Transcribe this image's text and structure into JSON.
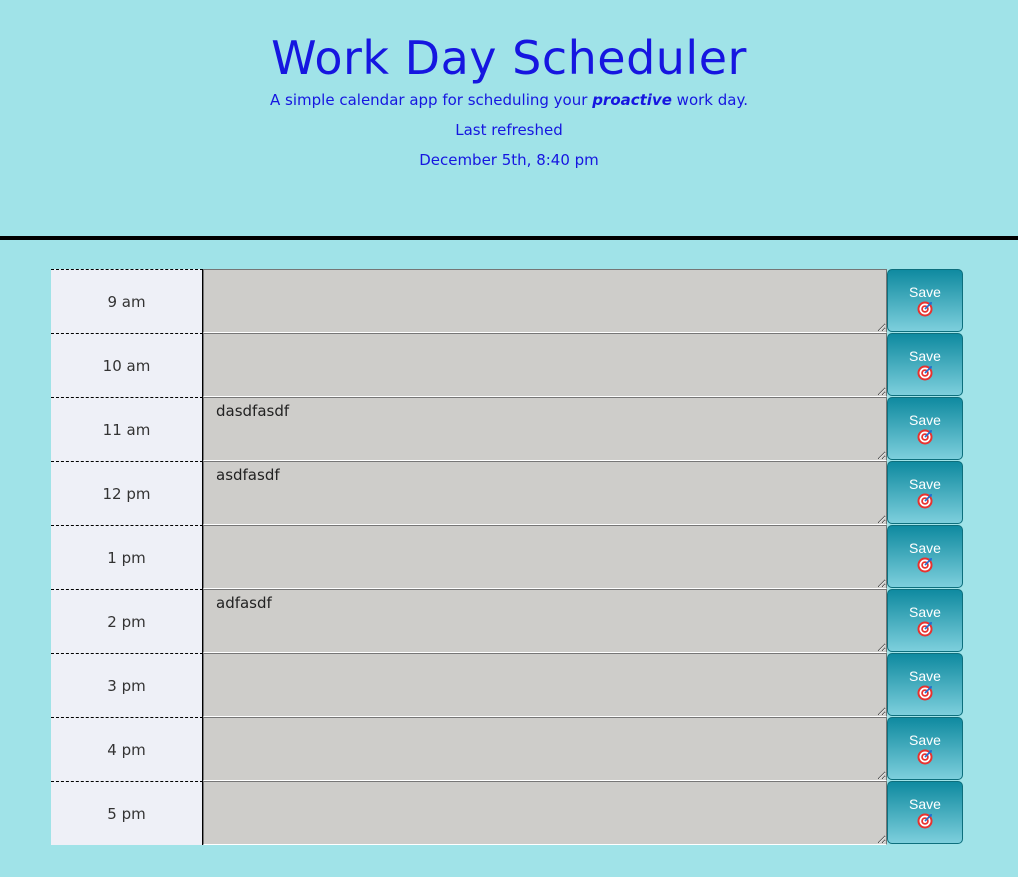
{
  "header": {
    "title": "Work Day Scheduler",
    "lead_before": "A simple calendar app for scheduling your ",
    "lead_emphasis": "proactive",
    "lead_after": " work day.",
    "refresh_label": "Last refreshed",
    "refresh_time": "December 5th, 8:40 pm"
  },
  "colors": {
    "background": "#a0e3e8",
    "title": "#1616e0",
    "hour_bg": "#eef0f7",
    "task_bg": "#cecdca",
    "save_button": "#0f8aa0"
  },
  "save_label": "Save",
  "save_icon": "target-icon",
  "slots": [
    {
      "hour": "9 am",
      "task": ""
    },
    {
      "hour": "10 am",
      "task": ""
    },
    {
      "hour": "11 am",
      "task": "dasdfasdf"
    },
    {
      "hour": "12 pm",
      "task": "asdfasdf"
    },
    {
      "hour": "1 pm",
      "task": ""
    },
    {
      "hour": "2 pm",
      "task": "adfasdf"
    },
    {
      "hour": "3 pm",
      "task": ""
    },
    {
      "hour": "4 pm",
      "task": ""
    },
    {
      "hour": "5 pm",
      "task": ""
    }
  ]
}
